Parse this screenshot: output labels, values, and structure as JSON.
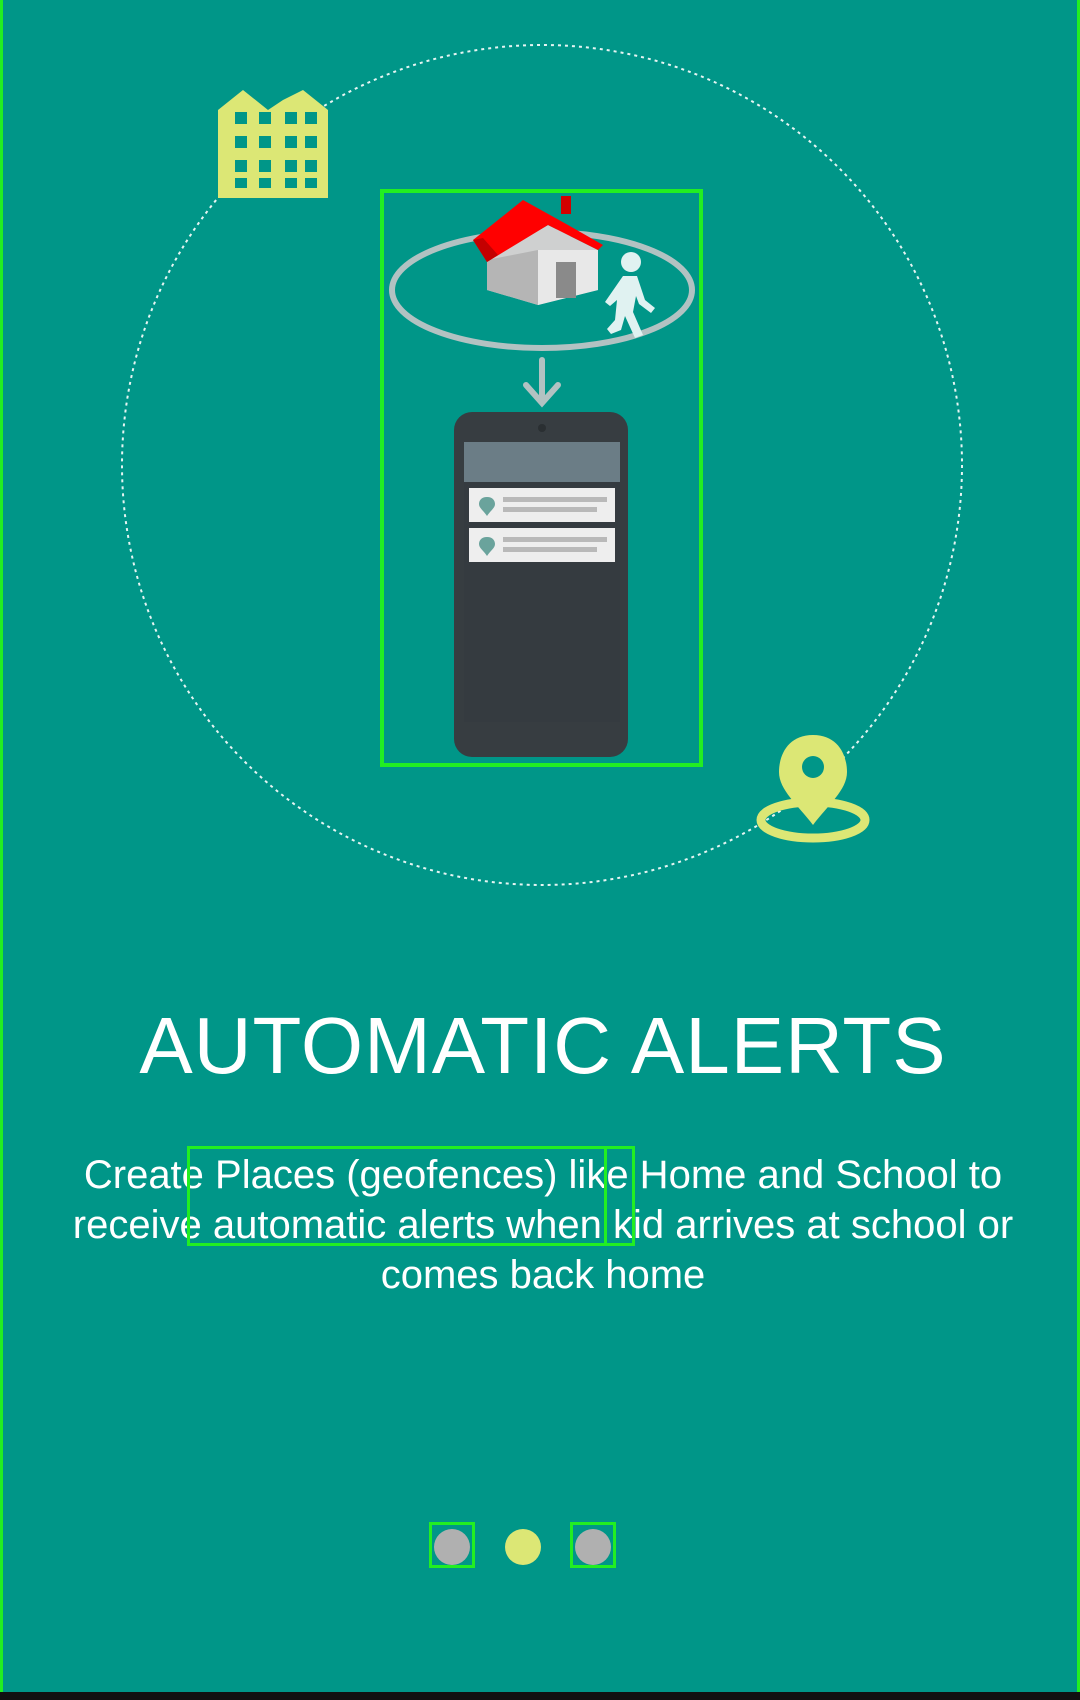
{
  "onboarding": {
    "title": "AUTOMATIC ALERTS",
    "description": "Create Places (geofences) like Home and School to receive automatic alerts when kid arrives at school or comes back home"
  },
  "pager": {
    "total_pages": 3,
    "active_index": 1
  },
  "icons": {
    "building": "building-icon",
    "location": "location-pin-icon",
    "house": "house-icon",
    "walker": "walking-person-icon",
    "arrow": "arrow-down-icon",
    "phone": "phone-icon",
    "notification_pin": "notification-pin-icon"
  },
  "colors": {
    "background": "#009688",
    "accent": "#dce775",
    "inactive_dot": "#b0b0b0",
    "roof": "#ff0000",
    "phone_body": "#373d41"
  }
}
